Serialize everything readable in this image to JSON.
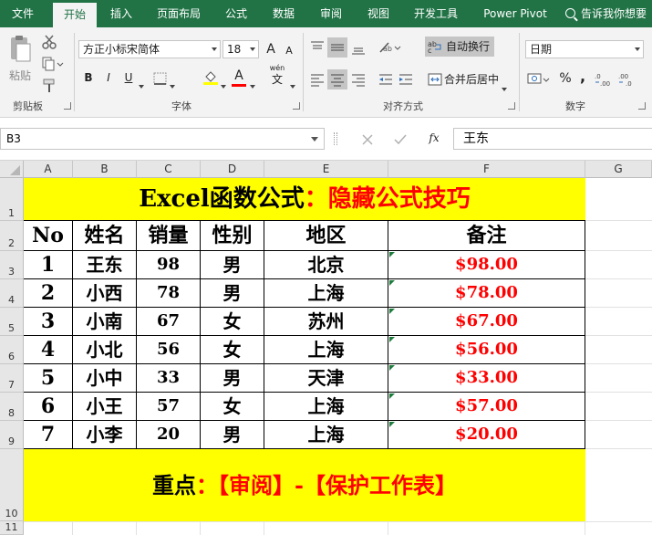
{
  "ribbon_tabs": [
    "文件",
    "开始",
    "插入",
    "页面布局",
    "公式",
    "数据",
    "审阅",
    "视图",
    "开发工具",
    "Power Pivot"
  ],
  "tell_me": "告诉我你想要",
  "clipboard": {
    "paste_label": "粘贴",
    "group_label": "剪贴板"
  },
  "font": {
    "name": "方正小标宋简体",
    "size": "18",
    "grow_label": "A",
    "shrink_label": "A",
    "bold_label": "B",
    "italic_label": "I",
    "underline_label": "U",
    "font_color_label": "A",
    "wen_label": "wén",
    "group_label": "字体"
  },
  "alignment": {
    "wrap_label": "自动换行",
    "merge_label": "合并后居中",
    "group_label": "对齐方式"
  },
  "number": {
    "format": "日期",
    "percent": "%",
    "comma": ",",
    "group_label": "数字"
  },
  "formula_bar": {
    "name_box": "B3",
    "fx": "fx",
    "content": "王东"
  },
  "columns": [
    "A",
    "B",
    "C",
    "D",
    "E",
    "F",
    "G"
  ],
  "rows": [
    "1",
    "2",
    "3",
    "4",
    "5",
    "6",
    "7",
    "8",
    "9",
    "10",
    "11"
  ],
  "sheet": {
    "title_black": "Excel函数公式",
    "title_red": "：隐藏公式技巧",
    "headers": [
      "No",
      "姓名",
      "销量",
      "性别",
      "地区",
      "备注"
    ],
    "data": [
      [
        "1",
        "王东",
        "98",
        "男",
        "北京",
        "$98.00"
      ],
      [
        "2",
        "小西",
        "78",
        "男",
        "上海",
        "$78.00"
      ],
      [
        "3",
        "小南",
        "67",
        "女",
        "苏州",
        "$67.00"
      ],
      [
        "4",
        "小北",
        "56",
        "女",
        "上海",
        "$56.00"
      ],
      [
        "5",
        "小中",
        "33",
        "男",
        "天津",
        "$33.00"
      ],
      [
        "6",
        "小王",
        "57",
        "女",
        "上海",
        "$57.00"
      ],
      [
        "7",
        "小李",
        "20",
        "男",
        "上海",
        "$20.00"
      ]
    ],
    "footer_black": "重点",
    "footer_red": "：【审阅】-【保护工作表】"
  },
  "colors": {
    "ribbon_green": "#217346",
    "highlight_yellow": "#ffff00",
    "accent_red": "#ff0000"
  }
}
